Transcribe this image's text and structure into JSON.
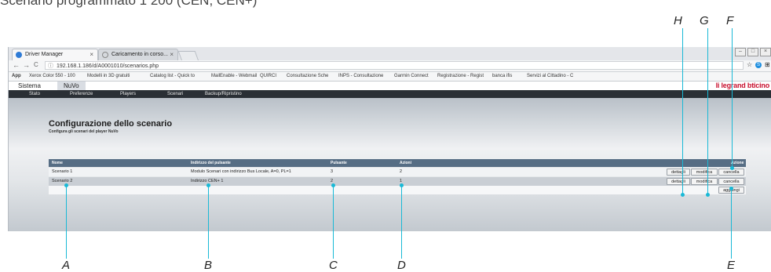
{
  "page_heading": "Scenario programmato 1 200 (CEN, CEN+)",
  "callout_letters": [
    "A",
    "B",
    "C",
    "D",
    "E",
    "F",
    "G",
    "H"
  ],
  "browser": {
    "tabs": [
      {
        "title": "Driver Manager",
        "close": "×"
      },
      {
        "title": "Caricamento in corso...",
        "close": "×"
      }
    ],
    "window_controls": [
      "–",
      "□",
      "×"
    ],
    "url": "192.168.1.186/d/A0001010/scenarios.php",
    "nav": {
      "back": "←",
      "forward": "→",
      "reload": "C",
      "info": "ⓘ"
    },
    "addr_ext": [
      "☆",
      "S",
      "⊞"
    ],
    "bookmarks": [
      "App",
      "Xerox Color 550 - 100",
      "Modelli in 3D gratuiti",
      "Catalog list - Quick to",
      "MailEnable - Webmail",
      "QUIRCI",
      "Consultazione Sche",
      "INPS - Consultazione",
      "Garmin Connect",
      "Registrazione - Regist",
      "banca ifis",
      "Servizi al Cittadino - C"
    ]
  },
  "app": {
    "top_tabs": [
      "Sistema",
      "NuVo"
    ],
    "logo_a": "li legrand",
    "logo_b": "bticino",
    "menu": [
      "Stato",
      "Preferenze",
      "Players",
      "Scenari",
      "Backup/Ripristino"
    ],
    "title": "Configurazione dello scenario",
    "subtitle": "Configura gli scenari del player NuVo"
  },
  "table": {
    "headers": {
      "nome": "Nome",
      "indirizzo": "Indirizzo del pulsante",
      "pulsante": "Pulsante",
      "azioni": "Azioni",
      "azione": "Azione"
    },
    "rows": [
      {
        "nome": "Scenario 1",
        "indirizzo": "Modulo Scenari con indirizzo Bus Locale, A=0, PL=1",
        "pulsante": "3",
        "azioni": "2"
      },
      {
        "nome": "Scenario 2",
        "indirizzo": "Indirizzo CEN+ 1",
        "pulsante": "2",
        "azioni": "1"
      }
    ],
    "buttons": {
      "dettagli": "dettagli",
      "modifica": "modifica",
      "cancella": "cancella",
      "aggiungi": "aggiungi"
    }
  },
  "colors": {
    "callout": "#19b9d6",
    "header_bg": "#566d84",
    "menu_bg": "#2a2f35",
    "logo_red": "#c8102e"
  }
}
